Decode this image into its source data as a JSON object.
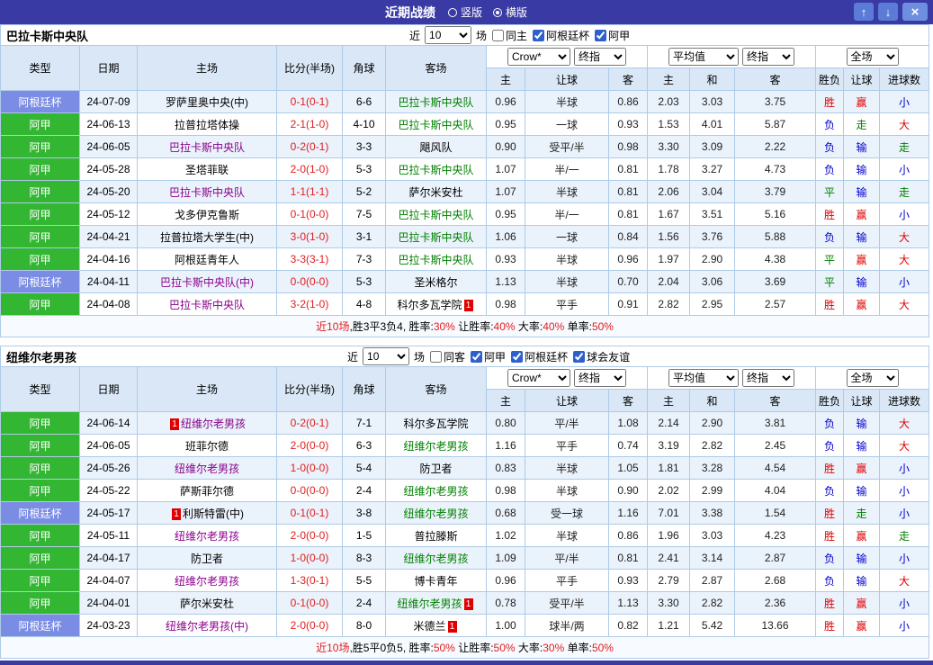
{
  "topbar": {
    "title": "近期战绩",
    "radios": [
      {
        "label": "竖版",
        "checked": false
      },
      {
        "label": "横版",
        "checked": true
      }
    ],
    "up_button": "↑",
    "down_button": "↓",
    "close_button": "×"
  },
  "league_colors": {
    "阿根廷杯": "#7B8CE4",
    "阿甲": "#33B733"
  },
  "role_colors": {
    "opp": "#000000",
    "self-home": "#8B008B",
    "self-away": "#008000"
  },
  "result_colors": {
    "胜": "#E00000",
    "赢": "#E00000",
    "大": "#E00000",
    "平": "#008000",
    "走": "#008000",
    "负": "#0000CC",
    "输": "#0000CC",
    "小": "#0000CC"
  },
  "columns": {
    "type": "类型",
    "date": "日期",
    "home": "主场",
    "score": "比分(半场)",
    "corner": "角球",
    "away": "客场",
    "odds_home": "主",
    "odds_handicap": "让球",
    "odds_away": "客",
    "avg_home": "主",
    "avg_draw": "和",
    "avg_away": "客",
    "res_wdl": "胜负",
    "res_handicap": "让球",
    "res_goals": "进球数"
  },
  "sections": [
    {
      "team": "巴拉卡斯中央队",
      "near": {
        "prefix": "近",
        "count": "10",
        "suffix": "场"
      },
      "checkboxes": [
        {
          "label": "同主",
          "checked": false
        },
        {
          "label": "阿根廷杯",
          "checked": true
        },
        {
          "label": "阿甲",
          "checked": true
        }
      ],
      "selects": {
        "company": "Crow*",
        "company_stage": "终指",
        "average": "平均值",
        "average_stage": "终指",
        "scope": "全场"
      },
      "rows": [
        {
          "league": "阿根廷杯",
          "date": "24-07-09",
          "home": {
            "name": "罗萨里奥中央(中)",
            "role": "opp"
          },
          "score": "0-1(0-1)",
          "corner": "6-6",
          "away": {
            "name": "巴拉卡斯中央队",
            "role": "self-away"
          },
          "odds": [
            "0.96",
            "半球",
            "0.86"
          ],
          "avg": [
            "2.03",
            "3.03",
            "3.75"
          ],
          "results": [
            "胜",
            "赢",
            "小"
          ]
        },
        {
          "league": "阿甲",
          "date": "24-06-13",
          "home": {
            "name": "拉普拉塔体操",
            "role": "opp"
          },
          "score": "2-1(1-0)",
          "corner": "4-10",
          "away": {
            "name": "巴拉卡斯中央队",
            "role": "self-away"
          },
          "odds": [
            "0.95",
            "一球",
            "0.93"
          ],
          "avg": [
            "1.53",
            "4.01",
            "5.87"
          ],
          "results": [
            "负",
            "走",
            "大"
          ]
        },
        {
          "league": "阿甲",
          "date": "24-06-05",
          "home": {
            "name": "巴拉卡斯中央队",
            "role": "self-home"
          },
          "score": "0-2(0-1)",
          "corner": "3-3",
          "away": {
            "name": "飓风队",
            "role": "opp"
          },
          "odds": [
            "0.90",
            "受平/半",
            "0.98"
          ],
          "avg": [
            "3.30",
            "3.09",
            "2.22"
          ],
          "results": [
            "负",
            "输",
            "走"
          ]
        },
        {
          "league": "阿甲",
          "date": "24-05-28",
          "home": {
            "name": "圣塔菲联",
            "role": "opp"
          },
          "score": "2-0(1-0)",
          "corner": "5-3",
          "away": {
            "name": "巴拉卡斯中央队",
            "role": "self-away"
          },
          "odds": [
            "1.07",
            "半/一",
            "0.81"
          ],
          "avg": [
            "1.78",
            "3.27",
            "4.73"
          ],
          "results": [
            "负",
            "输",
            "小"
          ]
        },
        {
          "league": "阿甲",
          "date": "24-05-20",
          "home": {
            "name": "巴拉卡斯中央队",
            "role": "self-home"
          },
          "score": "1-1(1-1)",
          "corner": "5-2",
          "away": {
            "name": "萨尔米安杜",
            "role": "opp"
          },
          "odds": [
            "1.07",
            "半球",
            "0.81"
          ],
          "avg": [
            "2.06",
            "3.04",
            "3.79"
          ],
          "results": [
            "平",
            "输",
            "走"
          ]
        },
        {
          "league": "阿甲",
          "date": "24-05-12",
          "home": {
            "name": "戈多伊克鲁斯",
            "role": "opp"
          },
          "score": "0-1(0-0)",
          "corner": "7-5",
          "away": {
            "name": "巴拉卡斯中央队",
            "role": "self-away"
          },
          "odds": [
            "0.95",
            "半/一",
            "0.81"
          ],
          "avg": [
            "1.67",
            "3.51",
            "5.16"
          ],
          "results": [
            "胜",
            "赢",
            "小"
          ]
        },
        {
          "league": "阿甲",
          "date": "24-04-21",
          "home": {
            "name": "拉普拉塔大学生(中)",
            "role": "opp"
          },
          "score": "3-0(1-0)",
          "corner": "3-1",
          "away": {
            "name": "巴拉卡斯中央队",
            "role": "self-away"
          },
          "odds": [
            "1.06",
            "一球",
            "0.84"
          ],
          "avg": [
            "1.56",
            "3.76",
            "5.88"
          ],
          "results": [
            "负",
            "输",
            "大"
          ]
        },
        {
          "league": "阿甲",
          "date": "24-04-16",
          "home": {
            "name": "阿根廷青年人",
            "role": "opp"
          },
          "score": "3-3(3-1)",
          "corner": "7-3",
          "away": {
            "name": "巴拉卡斯中央队",
            "role": "self-away"
          },
          "odds": [
            "0.93",
            "半球",
            "0.96"
          ],
          "avg": [
            "1.97",
            "2.90",
            "4.38"
          ],
          "results": [
            "平",
            "赢",
            "大"
          ]
        },
        {
          "league": "阿根廷杯",
          "date": "24-04-11",
          "home": {
            "name": "巴拉卡斯中央队(中)",
            "role": "self-home"
          },
          "score": "0-0(0-0)",
          "corner": "5-3",
          "away": {
            "name": "圣米格尔",
            "role": "opp"
          },
          "odds": [
            "1.13",
            "半球",
            "0.70"
          ],
          "avg": [
            "2.04",
            "3.06",
            "3.69"
          ],
          "results": [
            "平",
            "输",
            "小"
          ]
        },
        {
          "league": "阿甲",
          "date": "24-04-08",
          "home": {
            "name": "巴拉卡斯中央队",
            "role": "self-home"
          },
          "score": "3-2(1-0)",
          "corner": "4-8",
          "away": {
            "name": "科尔多瓦学院",
            "role": "opp",
            "badge": "1",
            "badge_side": "right"
          },
          "odds": [
            "0.98",
            "平手",
            "0.91"
          ],
          "avg": [
            "2.82",
            "2.95",
            "2.57"
          ],
          "results": [
            "胜",
            "赢",
            "大"
          ]
        }
      ],
      "summary": [
        {
          "text": "近10场",
          "red": true
        },
        {
          "text": ",胜3平3负4, 胜率:",
          "red": false
        },
        {
          "text": "30%",
          "red": true
        },
        {
          "text": " 让胜率:",
          "red": false
        },
        {
          "text": "40%",
          "red": true
        },
        {
          "text": " 大率:",
          "red": false
        },
        {
          "text": "40%",
          "red": true
        },
        {
          "text": " 单率:",
          "red": false
        },
        {
          "text": "50%",
          "red": true
        }
      ]
    },
    {
      "team": "纽维尔老男孩",
      "near": {
        "prefix": "近",
        "count": "10",
        "suffix": "场"
      },
      "checkboxes": [
        {
          "label": "同客",
          "checked": false
        },
        {
          "label": "阿甲",
          "checked": true
        },
        {
          "label": "阿根廷杯",
          "checked": true
        },
        {
          "label": "球会友谊",
          "checked": true
        }
      ],
      "selects": {
        "company": "Crow*",
        "company_stage": "终指",
        "average": "平均值",
        "average_stage": "终指",
        "scope": "全场"
      },
      "rows": [
        {
          "league": "阿甲",
          "date": "24-06-14",
          "home": {
            "name": "纽维尔老男孩",
            "role": "self-home",
            "badge": "1",
            "badge_side": "left"
          },
          "score": "0-2(0-1)",
          "corner": "7-1",
          "away": {
            "name": "科尔多瓦学院",
            "role": "opp"
          },
          "odds": [
            "0.80",
            "平/半",
            "1.08"
          ],
          "avg": [
            "2.14",
            "2.90",
            "3.81"
          ],
          "results": [
            "负",
            "输",
            "大"
          ]
        },
        {
          "league": "阿甲",
          "date": "24-06-05",
          "home": {
            "name": "班菲尔德",
            "role": "opp"
          },
          "score": "2-0(0-0)",
          "corner": "6-3",
          "away": {
            "name": "纽维尔老男孩",
            "role": "self-away"
          },
          "odds": [
            "1.16",
            "平手",
            "0.74"
          ],
          "avg": [
            "3.19",
            "2.82",
            "2.45"
          ],
          "results": [
            "负",
            "输",
            "大"
          ]
        },
        {
          "league": "阿甲",
          "date": "24-05-26",
          "home": {
            "name": "纽维尔老男孩",
            "role": "self-home"
          },
          "score": "1-0(0-0)",
          "corner": "5-4",
          "away": {
            "name": "防卫者",
            "role": "opp"
          },
          "odds": [
            "0.83",
            "半球",
            "1.05"
          ],
          "avg": [
            "1.81",
            "3.28",
            "4.54"
          ],
          "results": [
            "胜",
            "赢",
            "小"
          ]
        },
        {
          "league": "阿甲",
          "date": "24-05-22",
          "home": {
            "name": "萨斯菲尔德",
            "role": "opp"
          },
          "score": "0-0(0-0)",
          "corner": "2-4",
          "away": {
            "name": "纽维尔老男孩",
            "role": "self-away"
          },
          "odds": [
            "0.98",
            "半球",
            "0.90"
          ],
          "avg": [
            "2.02",
            "2.99",
            "4.04"
          ],
          "results": [
            "负",
            "输",
            "小"
          ]
        },
        {
          "league": "阿根廷杯",
          "date": "24-05-17",
          "home": {
            "name": "利斯特雷(中)",
            "role": "opp",
            "badge": "1",
            "badge_side": "left"
          },
          "score": "0-1(0-1)",
          "corner": "3-8",
          "away": {
            "name": "纽维尔老男孩",
            "role": "self-away"
          },
          "odds": [
            "0.68",
            "受一球",
            "1.16"
          ],
          "avg": [
            "7.01",
            "3.38",
            "1.54"
          ],
          "results": [
            "胜",
            "走",
            "小"
          ]
        },
        {
          "league": "阿甲",
          "date": "24-05-11",
          "home": {
            "name": "纽维尔老男孩",
            "role": "self-home"
          },
          "score": "2-0(0-0)",
          "corner": "1-5",
          "away": {
            "name": "普拉滕斯",
            "role": "opp"
          },
          "odds": [
            "1.02",
            "半球",
            "0.86"
          ],
          "avg": [
            "1.96",
            "3.03",
            "4.23"
          ],
          "results": [
            "胜",
            "赢",
            "走"
          ]
        },
        {
          "league": "阿甲",
          "date": "24-04-17",
          "home": {
            "name": "防卫者",
            "role": "opp"
          },
          "score": "1-0(0-0)",
          "corner": "8-3",
          "away": {
            "name": "纽维尔老男孩",
            "role": "self-away"
          },
          "odds": [
            "1.09",
            "平/半",
            "0.81"
          ],
          "avg": [
            "2.41",
            "3.14",
            "2.87"
          ],
          "results": [
            "负",
            "输",
            "小"
          ]
        },
        {
          "league": "阿甲",
          "date": "24-04-07",
          "home": {
            "name": "纽维尔老男孩",
            "role": "self-home"
          },
          "score": "1-3(0-1)",
          "corner": "5-5",
          "away": {
            "name": "博卡青年",
            "role": "opp"
          },
          "odds": [
            "0.96",
            "平手",
            "0.93"
          ],
          "avg": [
            "2.79",
            "2.87",
            "2.68"
          ],
          "results": [
            "负",
            "输",
            "大"
          ]
        },
        {
          "league": "阿甲",
          "date": "24-04-01",
          "home": {
            "name": "萨尔米安杜",
            "role": "opp"
          },
          "score": "0-1(0-0)",
          "corner": "2-4",
          "away": {
            "name": "纽维尔老男孩",
            "role": "self-away",
            "badge": "1",
            "badge_side": "right"
          },
          "odds": [
            "0.78",
            "受平/半",
            "1.13"
          ],
          "avg": [
            "3.30",
            "2.82",
            "2.36"
          ],
          "results": [
            "胜",
            "赢",
            "小"
          ]
        },
        {
          "league": "阿根廷杯",
          "date": "24-03-23",
          "home": {
            "name": "纽维尔老男孩(中)",
            "role": "self-home"
          },
          "score": "2-0(0-0)",
          "corner": "8-0",
          "away": {
            "name": "米德兰",
            "role": "opp",
            "badge": "1",
            "badge_side": "right"
          },
          "odds": [
            "1.00",
            "球半/两",
            "0.82"
          ],
          "avg": [
            "1.21",
            "5.42",
            "13.66"
          ],
          "results": [
            "胜",
            "赢",
            "小"
          ]
        }
      ],
      "summary": [
        {
          "text": "近10场",
          "red": true
        },
        {
          "text": ",胜5平0负5, 胜率:",
          "red": false
        },
        {
          "text": "50%",
          "red": true
        },
        {
          "text": " 让胜率:",
          "red": false
        },
        {
          "text": "50%",
          "red": true
        },
        {
          "text": " 大率:",
          "red": false
        },
        {
          "text": "30%",
          "red": true
        },
        {
          "text": " 单率:",
          "red": false
        },
        {
          "text": "50%",
          "red": true
        }
      ]
    }
  ]
}
